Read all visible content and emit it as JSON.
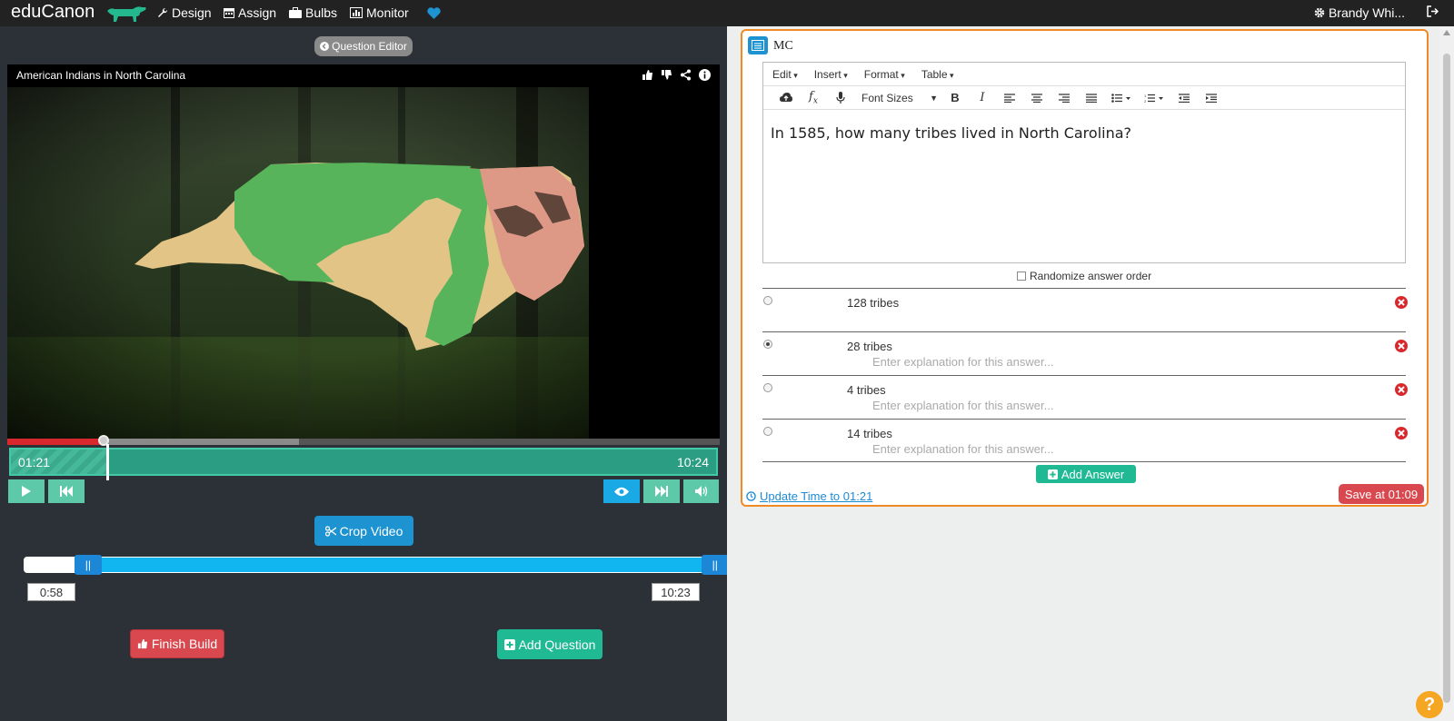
{
  "colors": {
    "nav_bg": "#222222",
    "panel_bg": "#2c3138",
    "accent_green": "#1fba94",
    "accent_blue": "#1d93d2",
    "danger": "#d9484f",
    "highlight": "#f08a24"
  },
  "nav": {
    "brand": "eduCanon",
    "items": [
      {
        "label": "Design",
        "icon": "wrench-icon"
      },
      {
        "label": "Assign",
        "icon": "calendar-icon"
      },
      {
        "label": "Bulbs",
        "icon": "briefcase-icon"
      },
      {
        "label": "Monitor",
        "icon": "chart-icon"
      }
    ],
    "user": "Brandy Whi..."
  },
  "editor_button": "Question Editor",
  "video": {
    "title": "American Indians in North Carolina",
    "played_fraction": 0.135,
    "buffered_fraction": 0.41,
    "elapsed": "01:21",
    "duration": "10:24"
  },
  "crop": {
    "button": "Crop Video",
    "start": "0:58",
    "end": "10:23",
    "start_fraction": 0.093,
    "end_fraction": 0.9984
  },
  "actions": {
    "finish": "Finish Build",
    "add_question": "Add Question"
  },
  "question": {
    "type": "MC",
    "menus": [
      "Edit",
      "Insert",
      "Format",
      "Table"
    ],
    "font_sizes": "Font Sizes",
    "text": "In 1585, how many tribes lived in North Carolina?",
    "randomize_label": "Randomize answer order",
    "answers": [
      {
        "text": "128 tribes",
        "explanation": "",
        "selected": false
      },
      {
        "text": "28 tribes",
        "explanation": "Enter explanation for this answer...",
        "selected": true
      },
      {
        "text": "4 tribes",
        "explanation": "Enter explanation for this answer...",
        "selected": false
      },
      {
        "text": "14 tribes",
        "explanation": "Enter explanation for this answer...",
        "selected": false
      }
    ],
    "add_answer": "Add Answer",
    "update_time": "Update Time to 01:21",
    "save": "Save at 01:09"
  },
  "help": "?"
}
